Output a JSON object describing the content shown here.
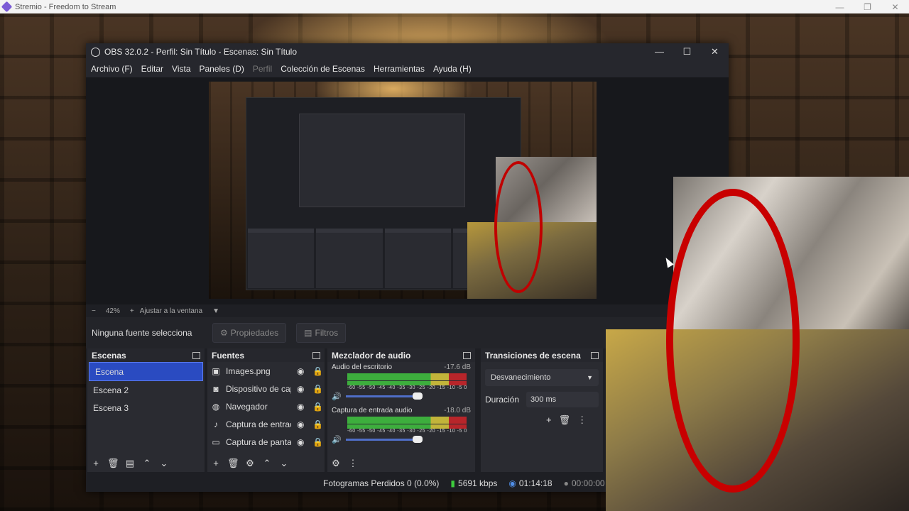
{
  "stremio": {
    "title": "Stremio - Freedom to Stream",
    "controls": [
      "—",
      "❐",
      "✕"
    ]
  },
  "obs": {
    "title": "OBS 32.0.2 - Perfil: Sin Título - Escenas: Sin Título",
    "window_controls": [
      "—",
      "☐",
      "✕"
    ],
    "menu": [
      "Archivo (F)",
      "Editar",
      "Vista",
      "Paneles (D)",
      "Perfil",
      "Colección de Escenas",
      "Herramientas",
      "Ayuda (H)"
    ],
    "zoom": {
      "minus": "−",
      "percent": "42%",
      "plus": "+",
      "fit": "Ajustar a la ventana",
      "dropdown": "▼"
    },
    "source_bar": {
      "none": "Ninguna fuente selecciona",
      "properties": "Propiedades",
      "filters": "Filtros"
    },
    "scenes": {
      "title": "Escenas",
      "items": [
        "Escena",
        "Escena 2",
        "Escena 3"
      ]
    },
    "sources": {
      "title": "Fuentes",
      "items": [
        "Images.png",
        "Dispositivo de cap",
        "Navegador",
        "Captura de entrac",
        "Captura de panta"
      ]
    },
    "mixer": {
      "title": "Mezclador de audio",
      "scale": "-60 -55 -50 -45 -40 -35 -30 -25 -20 -15 -10 -5 0",
      "channels": [
        {
          "name": "Audio del escritorio",
          "db": "-17.6 dB"
        },
        {
          "name": "Captura de entrada audio",
          "db": "-18.0 dB"
        }
      ]
    },
    "transitions": {
      "title": "Transiciones de escena",
      "selected": "Desvanecimiento",
      "duration_label": "Duración",
      "duration_value": "300 ms"
    },
    "status": {
      "dropped": "Fotogramas Perdidos 0 (0.0%)",
      "bitrate": "5691 kbps",
      "stream_time": "01:14:18",
      "rec_time": "00:00:00"
    }
  }
}
